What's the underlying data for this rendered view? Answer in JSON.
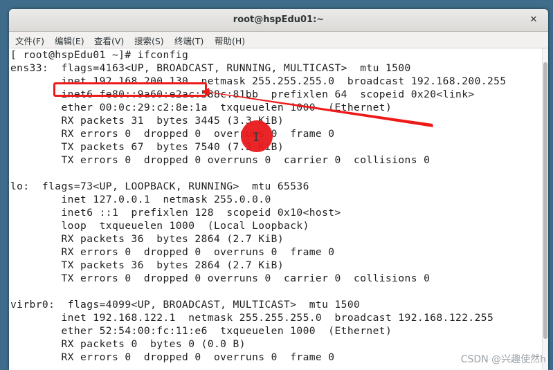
{
  "window": {
    "title": "root@hspEdu01:~",
    "close_symbol": "✕"
  },
  "menu": [
    {
      "label": "文件(F)"
    },
    {
      "label": "编辑(E)"
    },
    {
      "label": "查看(V)"
    },
    {
      "label": "搜索(S)"
    },
    {
      "label": "终端(T)"
    },
    {
      "label": "帮助(H)"
    }
  ],
  "terminal": {
    "lines": [
      "[ root@hspEdu01 ~]# ifconfig",
      "ens33:  flags=4163<UP, BROADCAST, RUNNING, MULTICAST>  mtu 1500",
      "        inet 192.168.200.130  netmask 255.255.255.0  broadcast 192.168.200.255",
      "        inet6 fe80::9a60:e2ac:588c:81bb  prefixlen 64  scopeid 0x20<link>",
      "        ether 00:0c:29:c2:8e:1a  txqueuelen 1000  (Ethernet)",
      "        RX packets 31  bytes 3445 (3.3 KiB)",
      "        RX errors 0  dropped 0  overruns 0  frame 0",
      "        TX packets 67  bytes 7540 (7.3 KiB)",
      "        TX errors 0  dropped 0 overruns 0  carrier 0  collisions 0",
      "",
      "lo:  flags=73<UP, LOOPBACK, RUNNING>  mtu 65536",
      "        inet 127.0.0.1  netmask 255.0.0.0",
      "        inet6 ::1  prefixlen 128  scopeid 0x10<host>",
      "        loop  txqueuelen 1000  (Local Loopback)",
      "        RX packets 36  bytes 2864 (2.7 KiB)",
      "        RX errors 0  dropped 0  overruns 0  frame 0",
      "        TX packets 36  bytes 2864 (2.7 KiB)",
      "        TX errors 0  dropped 0 overruns 0  carrier 0  collisions 0",
      "",
      "virbr0:  flags=4099<UP, BROADCAST, MULTICAST>  mtu 1500",
      "        inet 192.168.122.1  netmask 255.255.255.0  broadcast 192.168.122.255",
      "        ether 52:54:00:fc:11:e6  txqueuelen 1000  (Ethernet)",
      "        RX packets 0  bytes 0 (0.0 B)",
      "        RX errors 0  dropped 0  overruns 0  frame 0"
    ]
  },
  "annotation": {
    "highlight_color": "#ee1a1a",
    "arrow_color": "#ee1a1a",
    "cursor_dot_color": "#e8191c"
  },
  "watermark": "CSDN @兴趣使然h"
}
